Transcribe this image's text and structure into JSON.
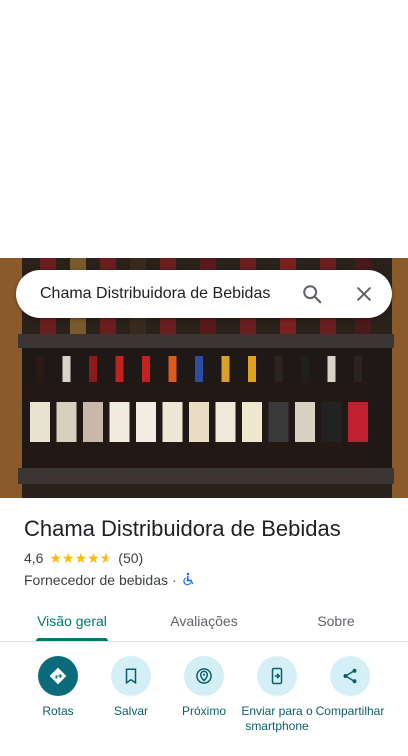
{
  "search": {
    "query": "Chama Distribuidora de Bebidas"
  },
  "place": {
    "name": "Chama Distribuidora de Bebidas",
    "rating": "4,6",
    "stars": 4.6,
    "review_count": "(50)",
    "category": "Fornecedor de bebidas",
    "separator": "·"
  },
  "tabs": [
    {
      "label": "Visão geral",
      "active": true
    },
    {
      "label": "Avaliações",
      "active": false
    },
    {
      "label": "Sobre",
      "active": false
    }
  ],
  "actions": [
    {
      "label": "Rotas",
      "icon": "directions-icon"
    },
    {
      "label": "Salvar",
      "icon": "bookmark-icon"
    },
    {
      "label": "Próximo",
      "icon": "nearby-icon"
    },
    {
      "label": "Enviar para o smartphone",
      "icon": "send-to-phone-icon"
    },
    {
      "label": "Compartilhar",
      "icon": "share-icon"
    }
  ],
  "colors": {
    "accent": "#00796b",
    "action_primary": "#0b6b7a",
    "action_bg": "#d4f0f6",
    "star": "#fbbc04"
  }
}
